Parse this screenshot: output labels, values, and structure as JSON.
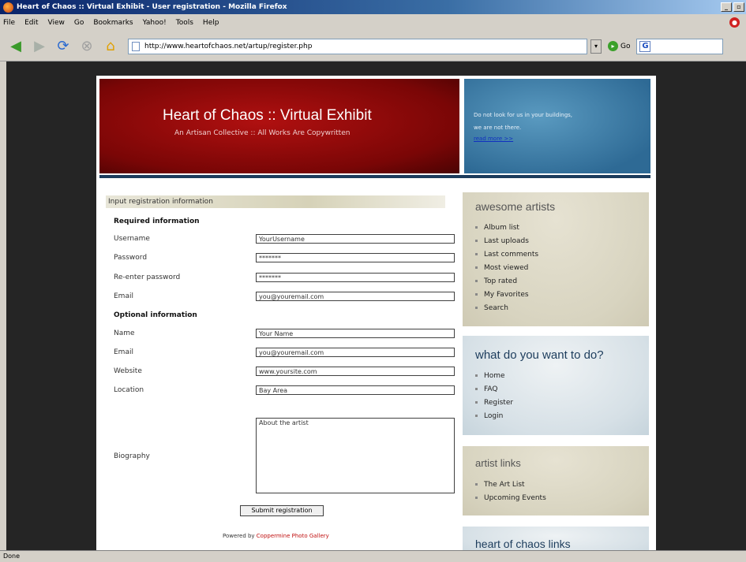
{
  "window": {
    "title": "Heart of Chaos :: Virtual Exhibit - User registration - Mozilla Firefox",
    "min_label": "_",
    "max_label": "▫"
  },
  "menu": {
    "items": [
      "File",
      "Edit",
      "View",
      "Go",
      "Bookmarks",
      "Yahoo!",
      "Tools",
      "Help"
    ]
  },
  "nav": {
    "url": "http://www.heartofchaos.net/artup/register.php",
    "go_label": "Go",
    "search_letter": "G"
  },
  "header": {
    "title": "Heart of Chaos :: Virtual Exhibit",
    "subtitle": "An Artisan Collective :: All Works Are Copywritten",
    "tagline_1": "Do not look for us in your buildings,",
    "tagline_2": "we are not there.",
    "read_more": "read more >>"
  },
  "form": {
    "title": "Input registration information",
    "required_heading": "Required information",
    "optional_heading": "Optional information",
    "required_fields": [
      {
        "label": "Username",
        "value": "YourUsername"
      },
      {
        "label": "Password",
        "value": "*******"
      },
      {
        "label": "Re-enter password",
        "value": "*******"
      },
      {
        "label": "Email",
        "value": "you@youremail.com"
      }
    ],
    "optional_fields": [
      {
        "label": "Name",
        "value": "Your Name"
      },
      {
        "label": "Email",
        "value": "you@youremail.com"
      },
      {
        "label": "Website",
        "value": "www.yoursite.com"
      },
      {
        "label": "Location",
        "value": "Bay Area"
      }
    ],
    "bio_label": "Biography",
    "bio_value": "About the artist",
    "submit_label": "Submit registration",
    "powered_prefix": "Powered by ",
    "powered_link": "Coppermine Photo Gallery"
  },
  "sidebar": {
    "artists": {
      "title": "awesome artists",
      "items": [
        "Album list",
        "Last uploads",
        "Last comments",
        "Most viewed",
        "Top rated",
        "My Favorites",
        "Search"
      ]
    },
    "todo": {
      "title": "what do you want to do?",
      "items": [
        "Home",
        "FAQ",
        "Register",
        "Login"
      ]
    },
    "links": {
      "title": "artist links",
      "items": [
        "The Art List",
        "Upcoming Events"
      ]
    },
    "hoc": {
      "title": "heart of chaos links"
    }
  },
  "status": {
    "text": "Done"
  }
}
